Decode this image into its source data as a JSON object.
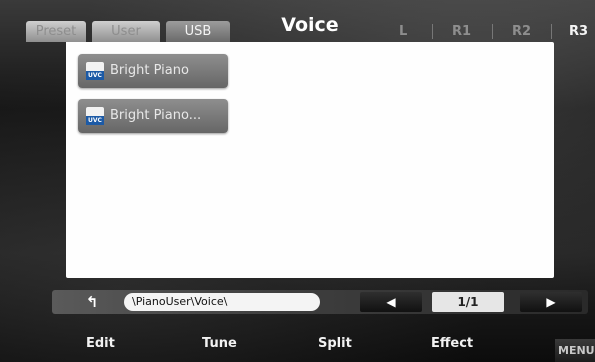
{
  "header": {
    "title": "Voice",
    "tabs": [
      {
        "label": "Preset",
        "active": false
      },
      {
        "label": "User",
        "active": false
      },
      {
        "label": "USB",
        "active": true
      }
    ],
    "parts": [
      "L",
      "R1",
      "R2",
      "R3"
    ],
    "active_part": "R3"
  },
  "files": [
    {
      "name": "Bright Piano",
      "icon": "uvc-file-icon",
      "icon_tag": "UVC"
    },
    {
      "name": "Bright Piano...",
      "icon": "uvc-file-icon",
      "icon_tag": "UVC"
    }
  ],
  "footer": {
    "up_icon": "↰",
    "path": "\\PianoUser\\Voice\\",
    "prev_icon": "◀",
    "next_icon": "▶",
    "page": "1/1"
  },
  "soft_buttons": {
    "edit": "Edit",
    "tune": "Tune",
    "split": "Split",
    "effect": "Effect",
    "menu": "MENU"
  },
  "colors": {
    "panel_bg": "#fefefe",
    "item_bg": "#7a7a7a",
    "active_tab": "#7e7e7e",
    "inactive_tab": "#b8b8b8",
    "icon_accent": "#1c5aa6"
  }
}
